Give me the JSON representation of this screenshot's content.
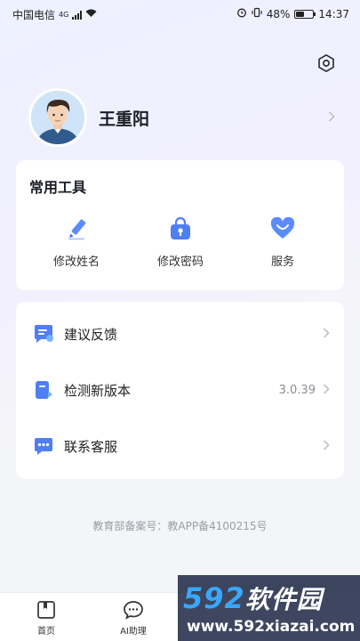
{
  "status_bar": {
    "carrier": "中国电信",
    "network": "4G",
    "battery": "48%",
    "battery_level": 0.48,
    "time": "14:37"
  },
  "header": {
    "settings_icon": "gear-icon"
  },
  "profile": {
    "name": "王重阳"
  },
  "tools": {
    "title": "常用工具",
    "items": [
      {
        "label": "修改姓名",
        "icon": "pencil-icon"
      },
      {
        "label": "修改密码",
        "icon": "lock-icon"
      },
      {
        "label": "服务",
        "icon": "heart-icon"
      }
    ]
  },
  "menu": {
    "items": [
      {
        "label": "建议反馈",
        "value": "",
        "icon": "feedback-icon"
      },
      {
        "label": "检测新版本",
        "value": "3.0.39",
        "icon": "version-icon"
      },
      {
        "label": "联系客服",
        "value": "",
        "icon": "chat-icon"
      }
    ]
  },
  "record": "教育部备案号：教APP备4100215号",
  "tabbar": {
    "items": [
      {
        "label": "首页",
        "icon": "home-icon"
      },
      {
        "label": "AI助理",
        "icon": "chat-bubble-icon"
      }
    ]
  },
  "watermark": {
    "brand_num": "592",
    "brand_cn": "软件园",
    "url": "www.592xiazai.com"
  },
  "colors": {
    "accent": "#3d7bf7",
    "heart": "#5a8cff"
  }
}
